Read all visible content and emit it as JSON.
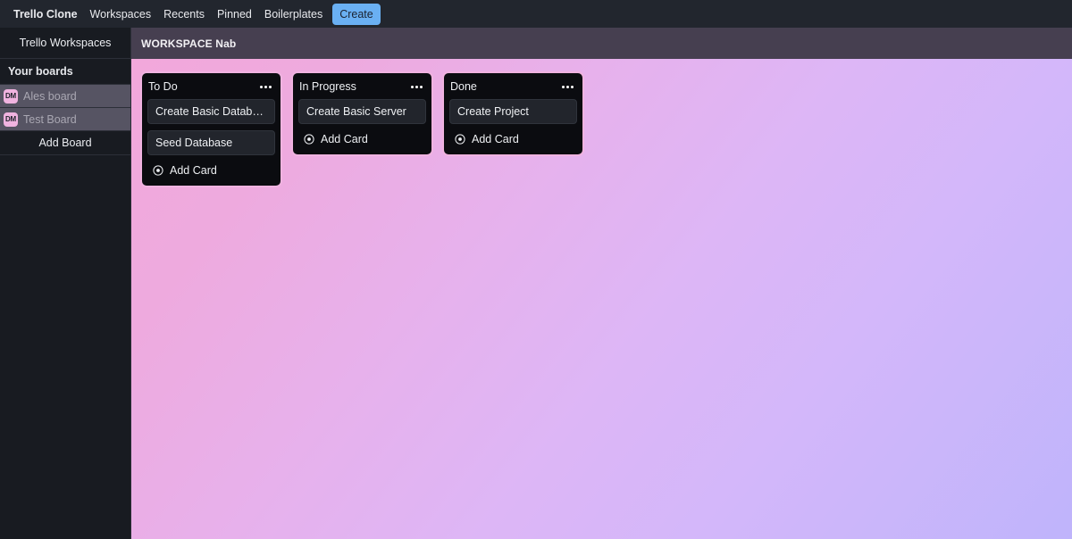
{
  "topnav": {
    "brand": "Trello Clone",
    "links": [
      {
        "label": "Workspaces",
        "name": "nav-workspaces"
      },
      {
        "label": "Recents",
        "name": "nav-recents"
      },
      {
        "label": "Pinned",
        "name": "nav-pinned"
      },
      {
        "label": "Boilerplates",
        "name": "nav-boilerplates"
      }
    ],
    "create_label": "Create",
    "create_accent": "#6ab0f3"
  },
  "sidebar": {
    "workspaces_title": "Trello Workspaces",
    "boards_heading": "Your boards",
    "boards": [
      {
        "avatar": "DM",
        "name": "Ales board"
      },
      {
        "avatar": "DM",
        "name": "Test Board"
      }
    ],
    "add_board_label": "Add Board",
    "avatar_color": "#f0b3e0"
  },
  "workspace": {
    "header_label": "WORKSPACE Nab",
    "header_color": "#463f50"
  },
  "board": {
    "background_from": "#f2a8db",
    "background_to": "#bfb4fb",
    "list_border_color": "#f0b3e0",
    "add_card_label": "Add Card",
    "add_card_icon": "circle-plus-icon",
    "menu_icon": "list-menu-ellipsis-icon",
    "lists": [
      {
        "title": "To Do",
        "cards": [
          {
            "title": "Create Basic Database"
          },
          {
            "title": "Seed Database"
          }
        ]
      },
      {
        "title": "In Progress",
        "cards": [
          {
            "title": "Create Basic Server"
          }
        ]
      },
      {
        "title": "Done",
        "cards": [
          {
            "title": "Create Project"
          }
        ]
      }
    ]
  }
}
